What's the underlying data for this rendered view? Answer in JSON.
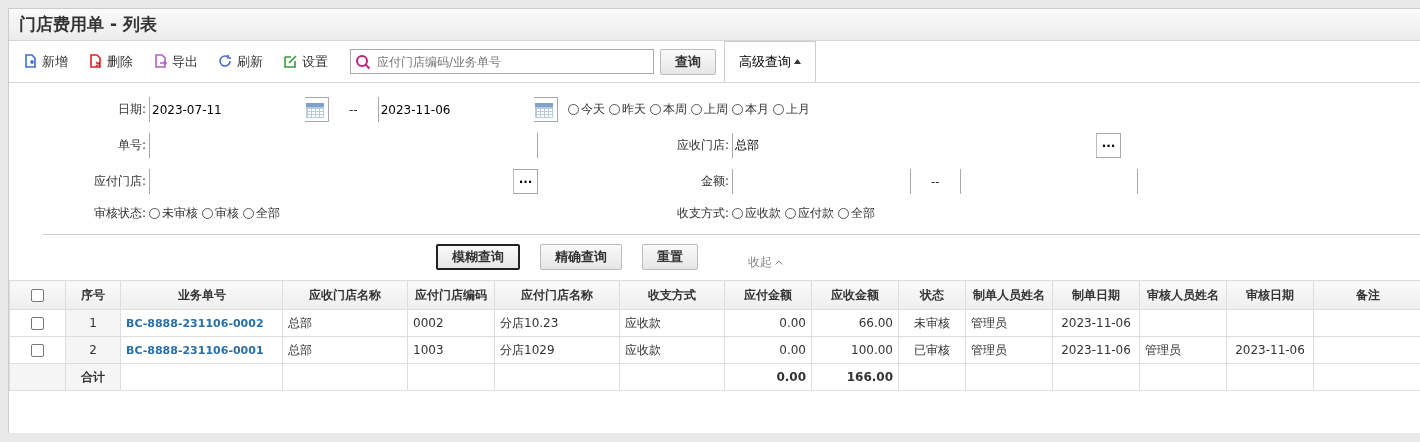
{
  "title": "门店费用单 - 列表",
  "toolbar": [
    {
      "kind": "add",
      "label": "新增"
    },
    {
      "kind": "delete",
      "label": "删除"
    },
    {
      "kind": "export",
      "label": "导出"
    },
    {
      "kind": "refresh",
      "label": "刷新"
    },
    {
      "kind": "settings",
      "label": "设置"
    }
  ],
  "search": {
    "placeholder": "应付门店编码/业务单号",
    "button": "查询",
    "advanced": "高级查询",
    "advanced_expanded": true
  },
  "filters": {
    "date": {
      "label": "日期:",
      "from": "2023-07-11",
      "separator": "--",
      "to": "2023-11-06",
      "quick": [
        {
          "label": "今天",
          "selected": false
        },
        {
          "label": "昨天",
          "selected": false
        },
        {
          "label": "本周",
          "selected": false
        },
        {
          "label": "上周",
          "selected": false
        },
        {
          "label": "本月",
          "selected": false
        },
        {
          "label": "上月",
          "selected": false
        }
      ]
    },
    "order_no": {
      "label": "单号:"
    },
    "receiving_store": {
      "label": "应收门店:",
      "value": "总部",
      "picker": "···"
    },
    "paying_store": {
      "label": "应付门店:",
      "picker": "···"
    },
    "amount": {
      "label": "金额:",
      "separator": "--"
    },
    "review_status": {
      "label": "审核状态:",
      "options": [
        {
          "label": "未审核",
          "selected": false
        },
        {
          "label": "审核",
          "selected": false
        },
        {
          "label": "全部",
          "selected": false
        }
      ]
    },
    "payment_type": {
      "label": "收支方式:",
      "options": [
        {
          "label": "应收款",
          "selected": false
        },
        {
          "label": "应付款",
          "selected": false
        },
        {
          "label": "全部",
          "selected": false
        }
      ]
    }
  },
  "actions": [
    {
      "label": "模糊查询",
      "focused": true
    },
    {
      "label": "精确查询",
      "focused": false
    },
    {
      "label": "重置",
      "focused": false
    }
  ],
  "collapse": "收起",
  "table": {
    "select_all": false,
    "columns": [
      "序号",
      "业务单号",
      "应收门店名称",
      "应付门店编码",
      "应付门店名称",
      "收支方式",
      "应付金额",
      "应收金额",
      "状态",
      "制单人员姓名",
      "制单日期",
      "审核人员姓名",
      "审核日期",
      "备注"
    ],
    "rows": [
      {
        "checked": false,
        "cells": [
          "1",
          "BC-8888-231106-0002",
          "总部",
          "0002",
          "分店10.23",
          "应收款",
          "0.00",
          "66.00",
          "未审核",
          "管理员",
          "2023-11-06",
          "",
          "",
          ""
        ]
      },
      {
        "checked": false,
        "cells": [
          "2",
          "BC-8888-231106-0001",
          "总部",
          "1003",
          "分店1029",
          "应收款",
          "0.00",
          "100.00",
          "已审核",
          "管理员",
          "2023-11-06",
          "管理员",
          "2023-11-06",
          ""
        ]
      }
    ],
    "total": {
      "label": "合计",
      "cells": [
        "",
        "",
        "",
        "",
        "",
        "",
        "0.00",
        "166.00",
        "",
        "",
        "",
        "",
        "",
        ""
      ]
    }
  }
}
